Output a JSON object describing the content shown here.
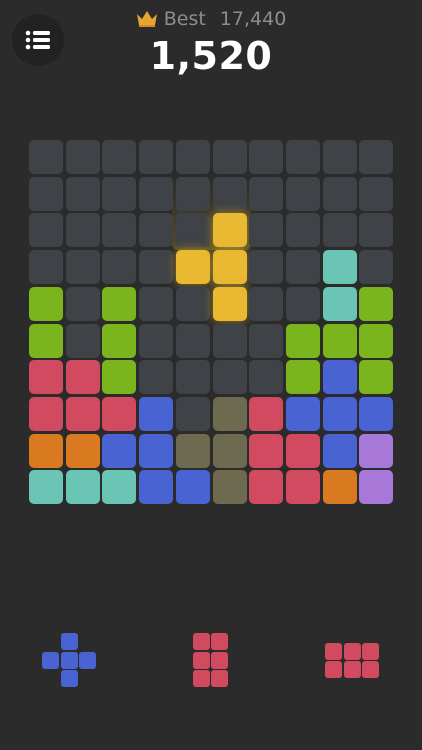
{
  "header": {
    "menu_icon": "list-menu-icon",
    "best_icon": "crown-icon",
    "best_label": "Best",
    "best_value": "17,440",
    "score": "1,520"
  },
  "colors": {
    "background": "#2b2b2b",
    "empty": "#3f4246",
    "G": "#7ab51d",
    "R": "#d24a5f",
    "B": "#4a63d2",
    "T": "#6bc5b4",
    "O": "#d97a20",
    "P": "#a878d8",
    "Y": "#e8b931",
    "H": "#6e6a4f"
  },
  "board": {
    "size": 10,
    "grid": [
      "..........",
      "..........",
      "..........",
      "........T.",
      "G.G.....TG",
      "G.G....GGG",
      "RRG....GBG",
      "RRRB.HRBBB",
      "OOBBHHRRBP",
      "TTTBBHRROP"
    ],
    "ghost_piece": {
      "color": "Y",
      "cells": [
        [
          5,
          2
        ],
        [
          5,
          3
        ],
        [
          4,
          3
        ],
        [
          5,
          4
        ]
      ]
    }
  },
  "tray": [
    {
      "name": "plus-piece",
      "color": "B",
      "cells": [
        [
          1,
          0
        ],
        [
          0,
          1
        ],
        [
          1,
          1
        ],
        [
          2,
          1
        ],
        [
          1,
          2
        ]
      ]
    },
    {
      "name": "two-by-three-piece",
      "color": "R",
      "cells": [
        [
          0,
          0
        ],
        [
          1,
          0
        ],
        [
          0,
          1
        ],
        [
          1,
          1
        ],
        [
          0,
          2
        ],
        [
          1,
          2
        ]
      ]
    },
    {
      "name": "three-by-two-piece",
      "color": "R",
      "cells": [
        [
          0,
          0
        ],
        [
          1,
          0
        ],
        [
          2,
          0
        ],
        [
          0,
          1
        ],
        [
          1,
          1
        ],
        [
          2,
          1
        ]
      ]
    }
  ]
}
